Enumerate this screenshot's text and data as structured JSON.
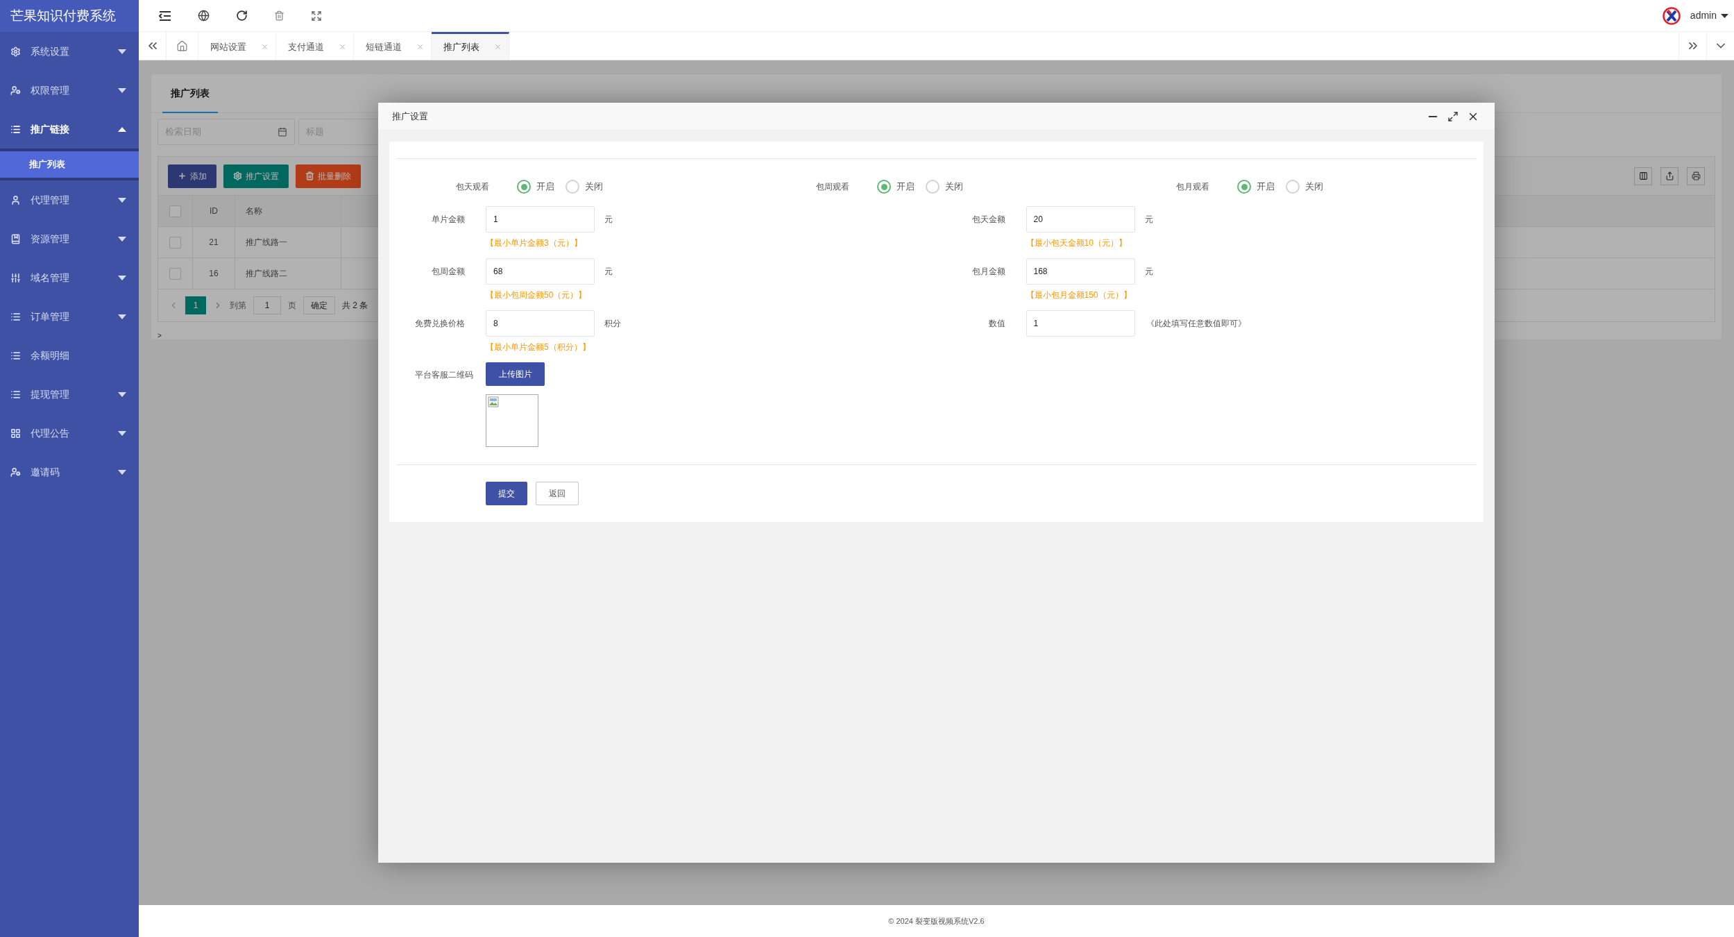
{
  "app": {
    "title": "芒果知识付费系统"
  },
  "sidebar": {
    "items": [
      {
        "label": "系统设置",
        "kind": "group",
        "expanded": false
      },
      {
        "label": "权限管理",
        "kind": "group",
        "expanded": false
      },
      {
        "label": "推广链接",
        "kind": "group",
        "expanded": true,
        "children": [
          {
            "label": "推广列表",
            "selected": true
          }
        ]
      },
      {
        "label": "代理管理",
        "kind": "group",
        "expanded": false
      },
      {
        "label": "资源管理",
        "kind": "group",
        "expanded": false
      },
      {
        "label": "域名管理",
        "kind": "group",
        "expanded": false
      },
      {
        "label": "订单管理",
        "kind": "group",
        "expanded": false
      },
      {
        "label": "余额明细",
        "kind": "link"
      },
      {
        "label": "提现管理",
        "kind": "group",
        "expanded": false
      },
      {
        "label": "代理公告",
        "kind": "group",
        "expanded": false
      },
      {
        "label": "邀请码",
        "kind": "group",
        "expanded": false
      }
    ]
  },
  "user": {
    "name": "admin"
  },
  "tabs": [
    {
      "label": "网站设置",
      "selected": false
    },
    {
      "label": "支付通道",
      "selected": false
    },
    {
      "label": "短链通道",
      "selected": false
    },
    {
      "label": "推广列表",
      "selected": true
    }
  ],
  "page": {
    "tab": "推广列表",
    "search": [
      {
        "placeholder": "检索日期"
      },
      {
        "placeholder": "标题"
      }
    ],
    "buttons": [
      {
        "label": "添加",
        "kind": "add"
      },
      {
        "label": "推广设置",
        "kind": "settings"
      },
      {
        "label": "批量删除",
        "kind": "delete"
      }
    ],
    "table": {
      "select_all_checked": false,
      "columns": [
        "ID",
        "名称"
      ],
      "rows": [
        {
          "checked": false,
          "cells": [
            "21",
            "推广线路一"
          ]
        },
        {
          "checked": false,
          "cells": [
            "16",
            "推广线路二"
          ]
        }
      ]
    },
    "pagination": {
      "current": "1",
      "goto_label": "到第",
      "page_input": "1",
      "page_unit": "页",
      "confirm": "确定",
      "total": "共 2 条"
    },
    "footnote": ">"
  },
  "dialog": {
    "title": "推广设置",
    "toggles": [
      {
        "label": "包天观看",
        "options": [
          {
            "label": "开启",
            "selected": true
          },
          {
            "label": "关闭",
            "selected": false
          }
        ]
      },
      {
        "label": "包周观看",
        "options": [
          {
            "label": "开启",
            "selected": true
          },
          {
            "label": "关闭",
            "selected": false
          }
        ]
      },
      {
        "label": "包月观看",
        "options": [
          {
            "label": "开启",
            "selected": true
          },
          {
            "label": "关闭",
            "selected": false
          }
        ]
      }
    ],
    "fields": [
      {
        "label": "单片金额",
        "value": "1",
        "unit": "元",
        "hint": "【最小单片金额3（元）】"
      },
      {
        "label": "包天金额",
        "value": "20",
        "unit": "元",
        "hint": "【最小包天金额10（元）】"
      },
      {
        "label": "包周金额",
        "value": "68",
        "unit": "元",
        "hint": "【最小包周金额50（元）】"
      },
      {
        "label": "包月金额",
        "value": "168",
        "unit": "元",
        "hint": "【最小包月金额150（元）】"
      },
      {
        "label": "免费兑换价格",
        "value": "8",
        "unit": "积分",
        "hint": "【最小单片金额5（积分）】"
      },
      {
        "label": "数值",
        "value": "1",
        "note": "《此处填写任意数值即可》"
      }
    ],
    "upload": {
      "label": "平台客服二维码",
      "button": "上传图片"
    },
    "buttons": [
      {
        "label": "提交",
        "kind": "primary"
      },
      {
        "label": "返回",
        "kind": "secondary"
      }
    ]
  },
  "footer": {
    "text": "© 2024 裂变版视频系统V2.6"
  }
}
